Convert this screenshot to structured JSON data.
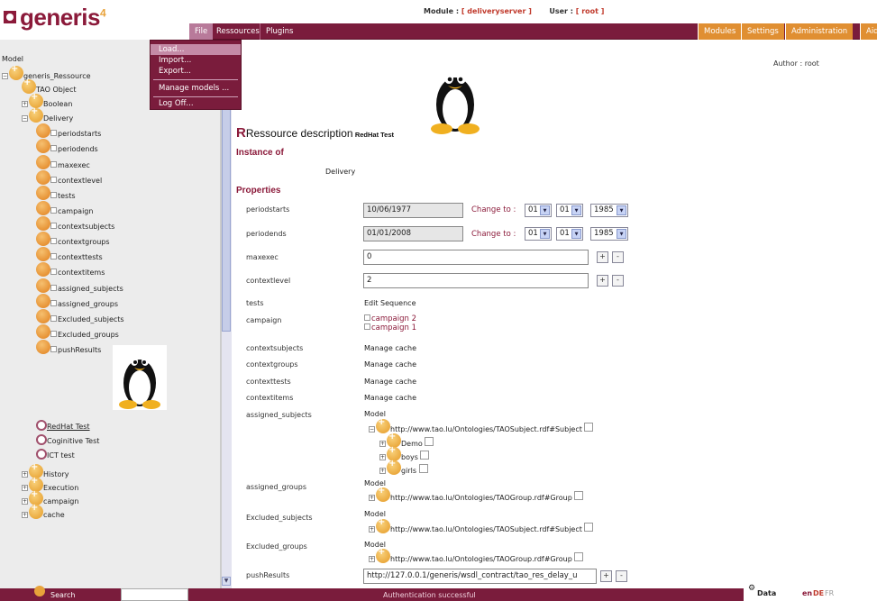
{
  "logo": {
    "brand": "generis",
    "version": "4"
  },
  "header": {
    "module_label": "Module :",
    "module_value": "[ deliveryserver ]",
    "user_label": "User :",
    "user_value": "[ root ]"
  },
  "menu": {
    "file": "File",
    "ressources": "Ressources",
    "plugins": "Plugins",
    "right": [
      "Modules",
      "Settings",
      "Administration",
      "Aid"
    ]
  },
  "file_menu": [
    "Load...",
    "Import...",
    "Export...",
    "Manage models ...",
    "Log Off..."
  ],
  "tree": {
    "root": "Model",
    "generis": "generis_Ressource",
    "tao_object": "TAO Object",
    "boolean": "Boolean",
    "delivery": "Delivery",
    "props": [
      "periodstarts",
      "periodends",
      "maxexec",
      "contextlevel",
      "tests",
      "campaign",
      "contextsubjects",
      "contextgroups",
      "contexttests",
      "contextitems",
      "assigned_subjects",
      "assigned_groups",
      "Excluded_subjects",
      "Excluded_groups",
      "pushResults"
    ],
    "instances": [
      "RedHat Test",
      "Coginitive Test",
      "ICT test"
    ],
    "bottom": [
      "History",
      "Execution",
      "campaign",
      "cache"
    ]
  },
  "main": {
    "author": "Author : root",
    "title_big": "Ressource description",
    "title_small": "RedHat Test",
    "instance_of": "Instance of",
    "instance_value": "Delivery",
    "properties": "Properties",
    "change_to": "Change to :",
    "labels": [
      "periodstarts",
      "periodends",
      "maxexec",
      "contextlevel",
      "tests",
      "campaign",
      "contextsubjects",
      "contextgroups",
      "contexttests",
      "contextitems",
      "assigned_subjects",
      "assigned_groups",
      "Excluded_subjects",
      "Excluded_groups",
      "pushResults"
    ],
    "periodstarts": "10/06/1977",
    "periodends": "01/01/2008",
    "sel1": [
      "01",
      "01",
      "1985"
    ],
    "sel2": [
      "01",
      "01",
      "1985"
    ],
    "maxexec": "0",
    "contextlevel": "2",
    "tests": "Edit Sequence",
    "campaigns": [
      "campaign 2",
      "campaign 1"
    ],
    "manage_cache": "Manage cache",
    "model": "Model",
    "subject_uri": "http://www.tao.lu/Ontologies/TAOSubject.rdf#Subject",
    "group_uri": "http://www.tao.lu/Ontologies/TAOGroup.rdf#Group",
    "subject_children": [
      "Demo",
      "boys",
      "girls"
    ],
    "push_value": "http://127.0.0.1/generis/wsdl_contract/tao_res_delay_u",
    "plus": "+",
    "minus": "-"
  },
  "footer": {
    "search": "Search",
    "status": "Authentication successful",
    "data": "Data",
    "langs": [
      "en",
      "DE",
      "FR"
    ]
  }
}
